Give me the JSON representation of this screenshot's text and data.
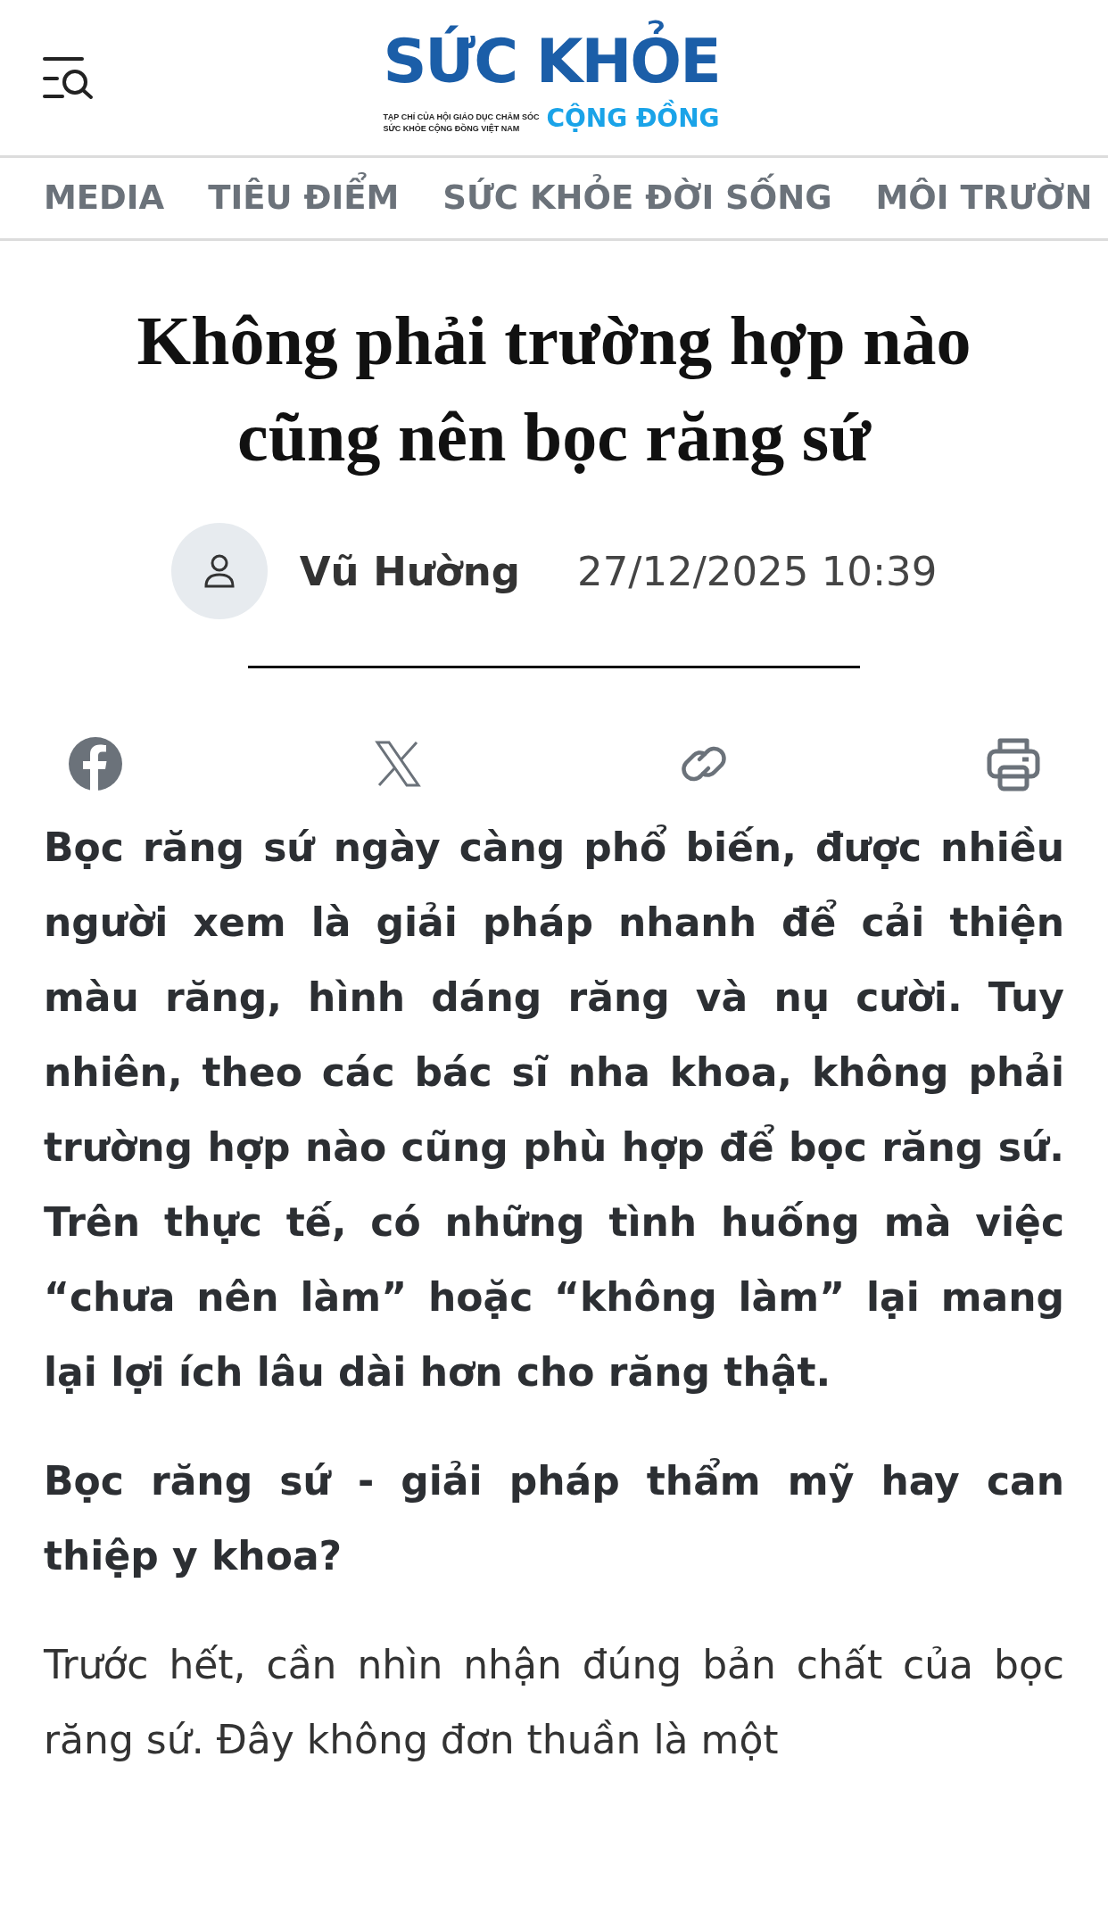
{
  "header": {
    "logo": {
      "title_dark": "SỨC KHỎE",
      "subtitle_line_1": "TẠP CHÍ CỦA HỘI GIÁO DỤC CHĂM SÓC",
      "subtitle_line_2": "SỨC KHỎE CỘNG ĐỒNG VIỆT NAM",
      "title_light": "CỘNG ĐỒNG"
    }
  },
  "nav": {
    "items": [
      {
        "label": "MEDIA"
      },
      {
        "label": "TIÊU ĐIỂM"
      },
      {
        "label": "SỨC KHỎE ĐỜI SỐNG"
      },
      {
        "label": "MÔI TRƯỜN"
      }
    ]
  },
  "article": {
    "title": "Không phải trường hợp nào cũng nên bọc răng sứ",
    "author": "Vũ Hường",
    "date": "27/12/2025 10:39",
    "lead": "Bọc răng sứ ngày càng phổ biến, được nhiều người xem là giải pháp nhanh để cải thiện màu răng, hình dáng răng và nụ cười. Tuy nhiên, theo các bác sĩ nha khoa, không phải trường hợp nào cũng phù hợp để bọc răng sứ. Trên thực tế, có những tình huống mà việc “chưa nên làm” hoặc “không làm” lại mang lại lợi ích lâu dài hơn cho răng thật.",
    "heading": "Bọc răng sứ - giải pháp thẩm mỹ hay can thiệp y khoa?",
    "body": "Trước hết, cần nhìn nhận đúng bản chất của bọc răng sứ. Đây không đơn thuần là một"
  }
}
